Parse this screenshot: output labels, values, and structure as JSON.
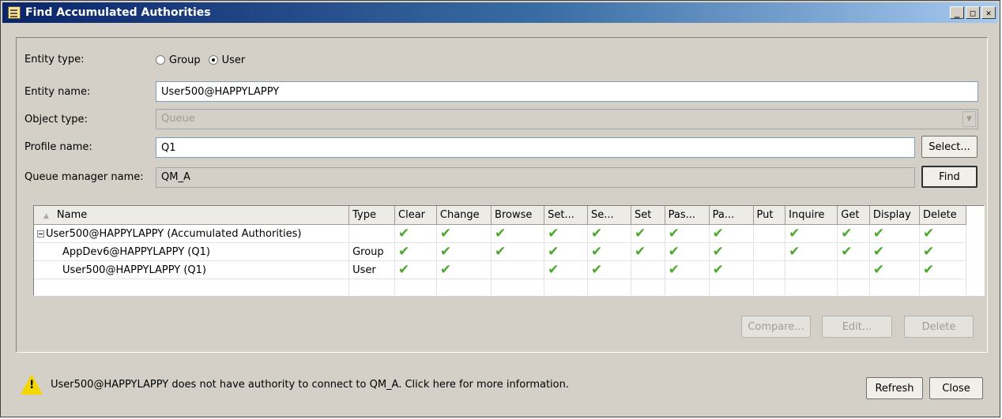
{
  "window": {
    "title": "Find Accumulated Authorities"
  },
  "form": {
    "entity_type_label": "Entity type:",
    "entity_type_options": [
      "Group",
      "User"
    ],
    "entity_type_selected": "User",
    "entity_name_label": "Entity name:",
    "entity_name_value": "User500@HAPPYLAPPY",
    "object_type_label": "Object type:",
    "object_type_value": "Queue",
    "profile_name_label": "Profile name:",
    "profile_name_value": "Q1",
    "queue_manager_label": "Queue manager name:",
    "queue_manager_value": "QM_A",
    "select_button": "Select...",
    "find_button": "Find"
  },
  "table": {
    "columns": [
      "Name",
      "Type",
      "Clear",
      "Change",
      "Browse",
      "Set...",
      "Se...",
      "Set",
      "Pas...",
      "Pa...",
      "Put",
      "Inquire",
      "Get",
      "Display",
      "Delete"
    ],
    "rows": [
      {
        "name": "User500@HAPPYLAPPY (Accumulated Authorities)",
        "type": "",
        "checks": [
          true,
          true,
          true,
          true,
          true,
          true,
          true,
          true,
          false,
          true,
          true,
          true,
          true
        ],
        "expanded": true,
        "level": 0
      },
      {
        "name": "AppDev6@HAPPYLAPPY (Q1)",
        "type": "Group",
        "checks": [
          true,
          true,
          true,
          true,
          true,
          true,
          true,
          true,
          false,
          true,
          true,
          true,
          true
        ],
        "level": 1
      },
      {
        "name": "User500@HAPPYLAPPY (Q1)",
        "type": "User",
        "checks": [
          true,
          true,
          false,
          true,
          true,
          false,
          true,
          true,
          false,
          false,
          false,
          true,
          true
        ],
        "level": 1
      }
    ]
  },
  "actions": {
    "compare": "Compare...",
    "edit": "Edit...",
    "delete": "Delete"
  },
  "status": {
    "message": "User500@HAPPYLAPPY does not have authority to connect to QM_A. Click here for more information.",
    "icon": "warning-icon"
  },
  "footer": {
    "refresh": "Refresh",
    "close": "Close"
  },
  "colors": {
    "title_start": "#0a246a",
    "title_end": "#a6caf0",
    "check": "#4aa82f",
    "warning": "#f6d600"
  }
}
